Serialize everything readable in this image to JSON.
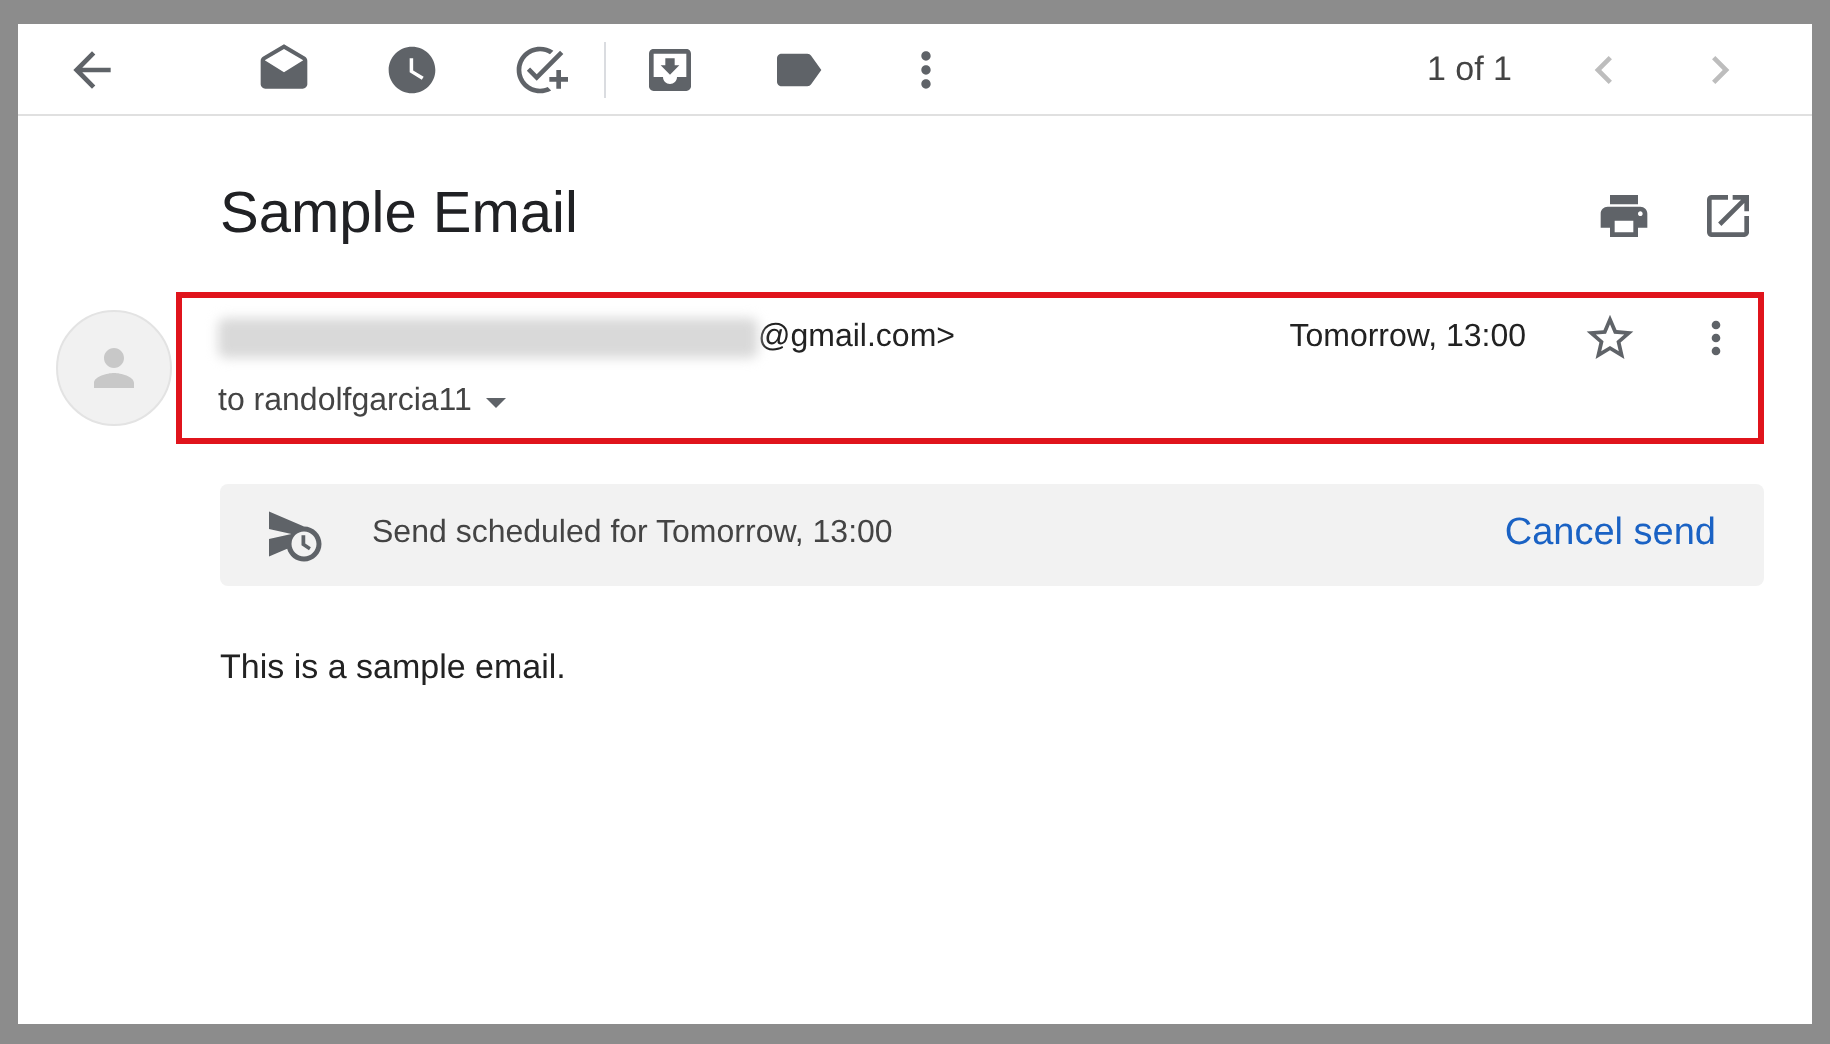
{
  "toolbar": {
    "pager": "1 of 1"
  },
  "email": {
    "subject": "Sample Email",
    "sender": {
      "address_tail": "@gmail.com>",
      "time": "Tomorrow, 13:00",
      "starred": false,
      "recipient": "to randolfgarcia11"
    },
    "scheduled": {
      "text": "Send scheduled for Tomorrow, 13:00",
      "action": "Cancel send"
    },
    "body": "This is a sample email."
  }
}
